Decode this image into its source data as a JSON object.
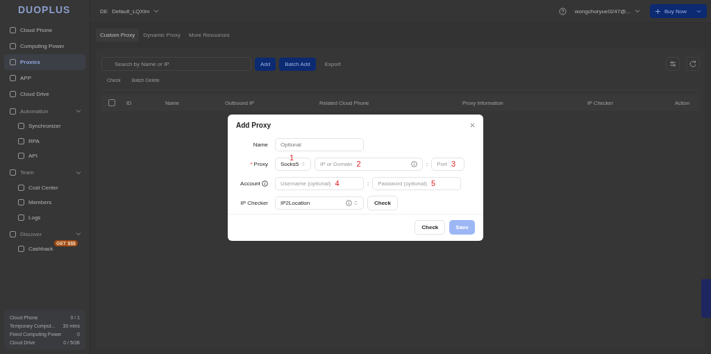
{
  "brand": "DUOPLUS",
  "team": {
    "code": "DE",
    "name": "Default_LQXlm"
  },
  "user": "wongchoryue0247@...",
  "buy_button": "Buy Now",
  "sidebar": {
    "items": [
      {
        "label": "Cloud Phone",
        "selected": false
      },
      {
        "label": "Computing Power",
        "selected": false
      },
      {
        "label": "Proxies",
        "selected": true
      },
      {
        "label": "APP",
        "selected": false
      },
      {
        "label": "Cloud Drive",
        "selected": false
      }
    ],
    "groups": [
      {
        "label": "Automation",
        "expanded": true,
        "children": [
          {
            "label": "Synchronizer"
          },
          {
            "label": "RPA"
          },
          {
            "label": "API"
          }
        ]
      },
      {
        "label": "Team",
        "expanded": true,
        "children": [
          {
            "label": "Cost Center"
          },
          {
            "label": "Members"
          },
          {
            "label": "Logs"
          }
        ]
      },
      {
        "label": "Discover",
        "expanded": true,
        "children": [
          {
            "label": "Cashback",
            "badge": "GET $$$"
          }
        ]
      }
    ],
    "usage": [
      {
        "label": "Cloud Phone",
        "value": "0 / 1"
      },
      {
        "label": "Temporary Comput...",
        "value": "30 mins"
      },
      {
        "label": "Fixed Computing Power",
        "value": "0"
      },
      {
        "label": "Cloud Drive",
        "value": "0 / 5GB"
      }
    ]
  },
  "tabs": [
    {
      "label": "Custom Proxy",
      "selected": true
    },
    {
      "label": "Dynamic Proxy",
      "selected": false
    },
    {
      "label": "More Resources",
      "selected": false
    }
  ],
  "search": {
    "placeholder": "Search by Name or IP"
  },
  "toolbar": {
    "add": "Add",
    "batch_add": "Batch Add",
    "export": "Export",
    "check": "Check",
    "batch_delete": "Batch Delete"
  },
  "table": {
    "select_all_checked": false,
    "columns": [
      "ID",
      "Name",
      "Outbound IP",
      "Related Cloud Phone",
      "Proxy Information",
      "IP Checker",
      "Action"
    ]
  },
  "dialog": {
    "title": "Add Proxy",
    "name_label": "Name",
    "name_placeholder": "Optional",
    "proxy_label": "Proxy",
    "proxy_required": true,
    "required_mark": "*",
    "separator": ":",
    "proxy_type": "Socks5",
    "host_placeholder": "IP or Domain",
    "port_placeholder": "Port",
    "account_label": "Account",
    "username_placeholder": "Username (optional)",
    "password_placeholder": "Password (optional)",
    "checker_label": "IP Checker",
    "checker_value": "IP2Location",
    "checker_button": "Check",
    "check_button": "Check",
    "save_button": "Save",
    "save_disabled": true,
    "annotations": [
      "1",
      "2",
      "3",
      "4",
      "5"
    ]
  }
}
